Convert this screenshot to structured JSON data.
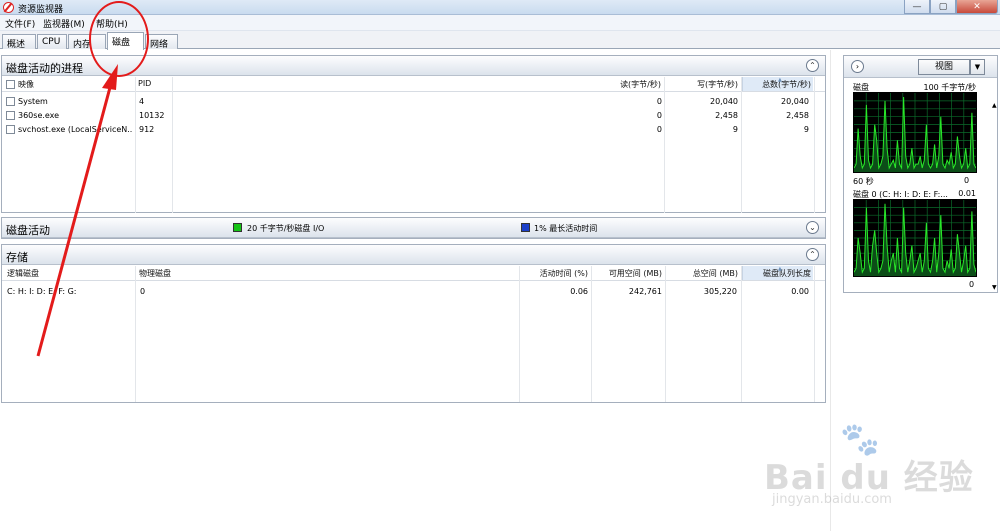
{
  "window": {
    "title": "资源监视器"
  },
  "menu": [
    "文件(F)",
    "监视器(M)",
    "帮助(H)"
  ],
  "tabs": [
    "概述",
    "CPU",
    "内存",
    "磁盘",
    "网络"
  ],
  "active_tab": "磁盘",
  "processes": {
    "title": "磁盘活动的进程",
    "columns": [
      "映像",
      "PID",
      "读(字节/秒)",
      "写(字节/秒)",
      "总数(字节/秒)"
    ],
    "rows": [
      {
        "image": "System",
        "pid": "4",
        "read": "0",
        "write": "20,040",
        "total": "20,040"
      },
      {
        "image": "360se.exe",
        "pid": "10132",
        "read": "0",
        "write": "2,458",
        "total": "2,458"
      },
      {
        "image": "svchost.exe (LocalServiceN...",
        "pid": "912",
        "read": "0",
        "write": "9",
        "total": "9"
      }
    ]
  },
  "disk_activity": {
    "title": "磁盘活动",
    "legend1": "20 千字节/秒磁盘 I/O",
    "legend2": "1% 最长活动时间",
    "legend1_color": "#16c416",
    "legend2_color": "#1b3fc8"
  },
  "storage": {
    "title": "存储",
    "columns": [
      "逻辑磁盘",
      "物理磁盘",
      "活动时间 (%)",
      "可用空间 (MB)",
      "总空间 (MB)",
      "磁盘队列长度"
    ],
    "rows": [
      {
        "logical": "C: H: I: D: E: F: G:",
        "physical": "0",
        "active": "0.06",
        "free": "242,761",
        "total": "305,220",
        "queue": "0.00"
      }
    ]
  },
  "side_panel": {
    "view_label": "视图",
    "graph1_title": "磁盘",
    "graph1_scale": "100 千字节/秒",
    "graph1_time": "60 秒",
    "graph1_min": "0",
    "graph2_title": "磁盘 0 (C: H: I: D: E: F:...",
    "graph2_max": "0.01",
    "graph2_min": "0",
    "graph1_values": [
      0.05,
      0.1,
      0.55,
      0.2,
      0.05,
      0.1,
      0.85,
      0.15,
      0.05,
      0.1,
      0.6,
      0.4,
      0.05,
      0.1,
      0.2,
      0.9,
      0.3,
      0.05,
      0.1,
      0.15,
      0.05,
      0.4,
      0.1,
      0.05,
      0.95,
      0.2,
      0.05,
      0.1,
      0.3,
      0.05,
      0.1,
      0.1,
      0.2,
      0.05,
      0.15,
      0.6,
      0.1,
      0.05,
      0.1,
      0.35,
      0.05,
      0.2,
      0.7,
      0.1,
      0.05,
      0.15,
      0.1,
      0.25,
      0.05,
      0.1,
      0.45,
      0.2,
      0.05,
      0.1,
      0.3,
      0.05,
      0.1,
      0.75,
      0.1,
      0.05
    ],
    "graph2_values": [
      0.05,
      0.1,
      0.5,
      0.3,
      0.05,
      0.1,
      0.9,
      0.2,
      0.05,
      0.4,
      0.6,
      0.3,
      0.05,
      0.1,
      0.2,
      0.95,
      0.4,
      0.05,
      0.2,
      0.3,
      0.05,
      0.5,
      0.1,
      0.05,
      0.9,
      0.3,
      0.05,
      0.2,
      0.4,
      0.05,
      0.1,
      0.2,
      0.3,
      0.05,
      0.2,
      0.7,
      0.1,
      0.05,
      0.2,
      0.5,
      0.05,
      0.3,
      0.8,
      0.1,
      0.05,
      0.2,
      0.1,
      0.35,
      0.05,
      0.1,
      0.55,
      0.3,
      0.05,
      0.2,
      0.4,
      0.05,
      0.1,
      0.85,
      0.15,
      0.05
    ]
  },
  "watermark": {
    "brand": "Bai du 经验",
    "url": "jingyan.baidu.com"
  }
}
